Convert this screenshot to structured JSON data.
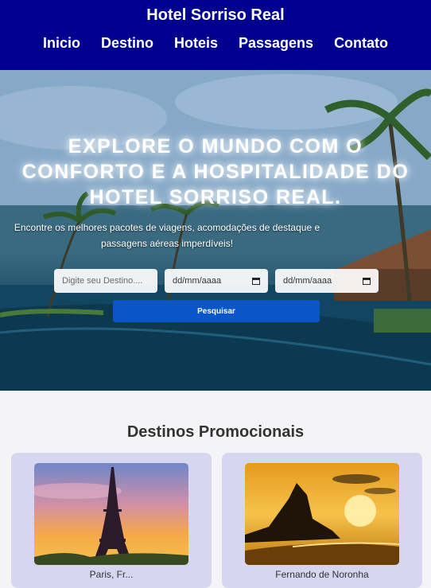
{
  "header": {
    "title": "Hotel Sorriso Real",
    "nav": [
      "Inicio",
      "Destino",
      "Hoteis",
      "Passagens",
      "Contato"
    ]
  },
  "hero": {
    "heading": "EXPLORE O MUNDO COM O CONFORTO E A HOSPITALIDADE DO HOTEL SORRISO REAL.",
    "subtitle": "Encontre os melhores pacotes de viagens, acomodações de destaque e passagens aéreas imperdíveis!",
    "destination_placeholder": "Digite seu Destino....",
    "date_in": "dd/mm/aaaa",
    "date_out": "dd/mm/aaaa",
    "search_label": "Pesquisar"
  },
  "promotions": {
    "title": "Destinos Promocionais",
    "cards": [
      {
        "caption": "Paris, Fr..."
      },
      {
        "caption": "Fernando de Noronha"
      }
    ]
  },
  "colors": {
    "header_bg": "#00008e",
    "button_bg": "#0a56c9",
    "card_bg": "#d6d6f0"
  }
}
